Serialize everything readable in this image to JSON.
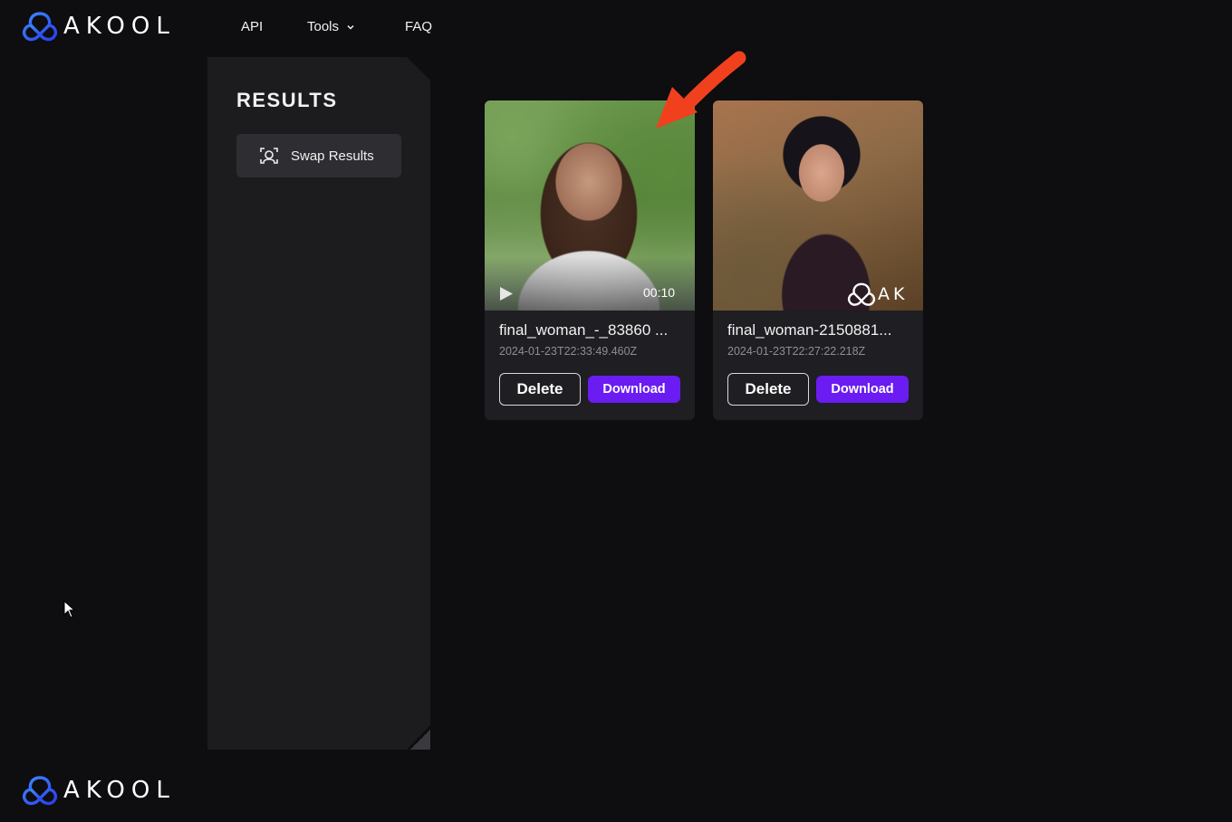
{
  "header": {
    "brand": "AKOOL",
    "nav": [
      {
        "label": "API"
      },
      {
        "label": "Tools"
      },
      {
        "label": "FAQ"
      }
    ]
  },
  "sidebar": {
    "title": "RESULTS",
    "items": [
      {
        "label": "Swap Results",
        "icon": "face-scan-icon"
      }
    ]
  },
  "results": [
    {
      "name": "final_woman_-_83860 ...",
      "date": "2024-01-23T22:33:49.460Z",
      "duration": "00:10",
      "type": "video",
      "delete_label": "Delete",
      "download_label": "Download"
    },
    {
      "name": "final_woman-2150881...",
      "date": "2024-01-23T22:27:22.218Z",
      "type": "image",
      "watermark": "AK",
      "delete_label": "Delete",
      "download_label": "Download"
    }
  ],
  "footer": {
    "brand": "AKOOL"
  },
  "colors": {
    "background": "#0e0d0f",
    "sidebar": "#1c1b1e",
    "card": "#1f1e22",
    "accent": "#6a1cf2",
    "logo_blue": "#2f6bff",
    "annotation": "#f0401e"
  }
}
